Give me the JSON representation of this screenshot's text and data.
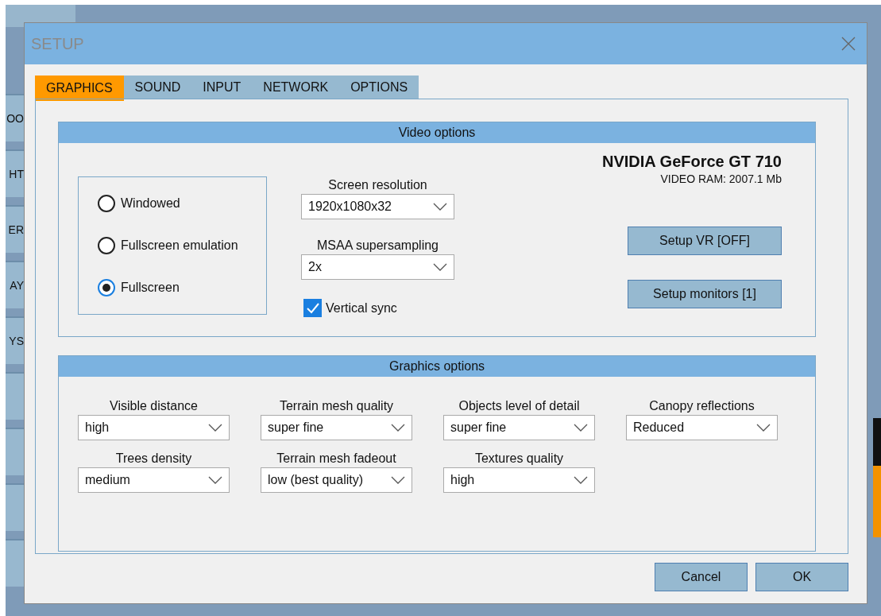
{
  "background_app": {
    "side_buttons": [
      "OO",
      "HT",
      "ER",
      "AY",
      "YS"
    ]
  },
  "window": {
    "title": "SETUP"
  },
  "tabs": [
    {
      "label": "GRAPHICS",
      "selected": true
    },
    {
      "label": "SOUND",
      "selected": false
    },
    {
      "label": "INPUT",
      "selected": false
    },
    {
      "label": "NETWORK",
      "selected": false
    },
    {
      "label": "OPTIONS",
      "selected": false
    }
  ],
  "video_options": {
    "title": "Video options",
    "display_modes": [
      {
        "label": "Windowed",
        "selected": false
      },
      {
        "label": "Fullscreen emulation",
        "selected": false
      },
      {
        "label": "Fullscreen",
        "selected": true
      }
    ],
    "screen_resolution": {
      "label": "Screen resolution",
      "value": "1920x1080x32"
    },
    "msaa": {
      "label": "MSAA supersampling",
      "value": "2x"
    },
    "vertical_sync": {
      "label": "Vertical sync",
      "checked": true
    },
    "gpu_name": "NVIDIA GeForce GT 710",
    "video_ram": "VIDEO RAM: 2007.1 Mb",
    "buttons": [
      "Setup VR [OFF]",
      "Setup monitors [1]"
    ]
  },
  "graphics_options": {
    "title": "Graphics options",
    "settings": [
      {
        "label": "Visible distance",
        "value": "high"
      },
      {
        "label": "Terrain mesh quality",
        "value": "super fine"
      },
      {
        "label": "Objects level of detail",
        "value": "super fine"
      },
      {
        "label": "Canopy reflections",
        "value": "Reduced"
      },
      {
        "label": "Trees density",
        "value": "medium"
      },
      {
        "label": "Terrain mesh fadeout",
        "value": "low (best quality)"
      },
      {
        "label": "Textures quality",
        "value": "high"
      }
    ]
  },
  "buttons": [
    "Cancel",
    "OK"
  ]
}
